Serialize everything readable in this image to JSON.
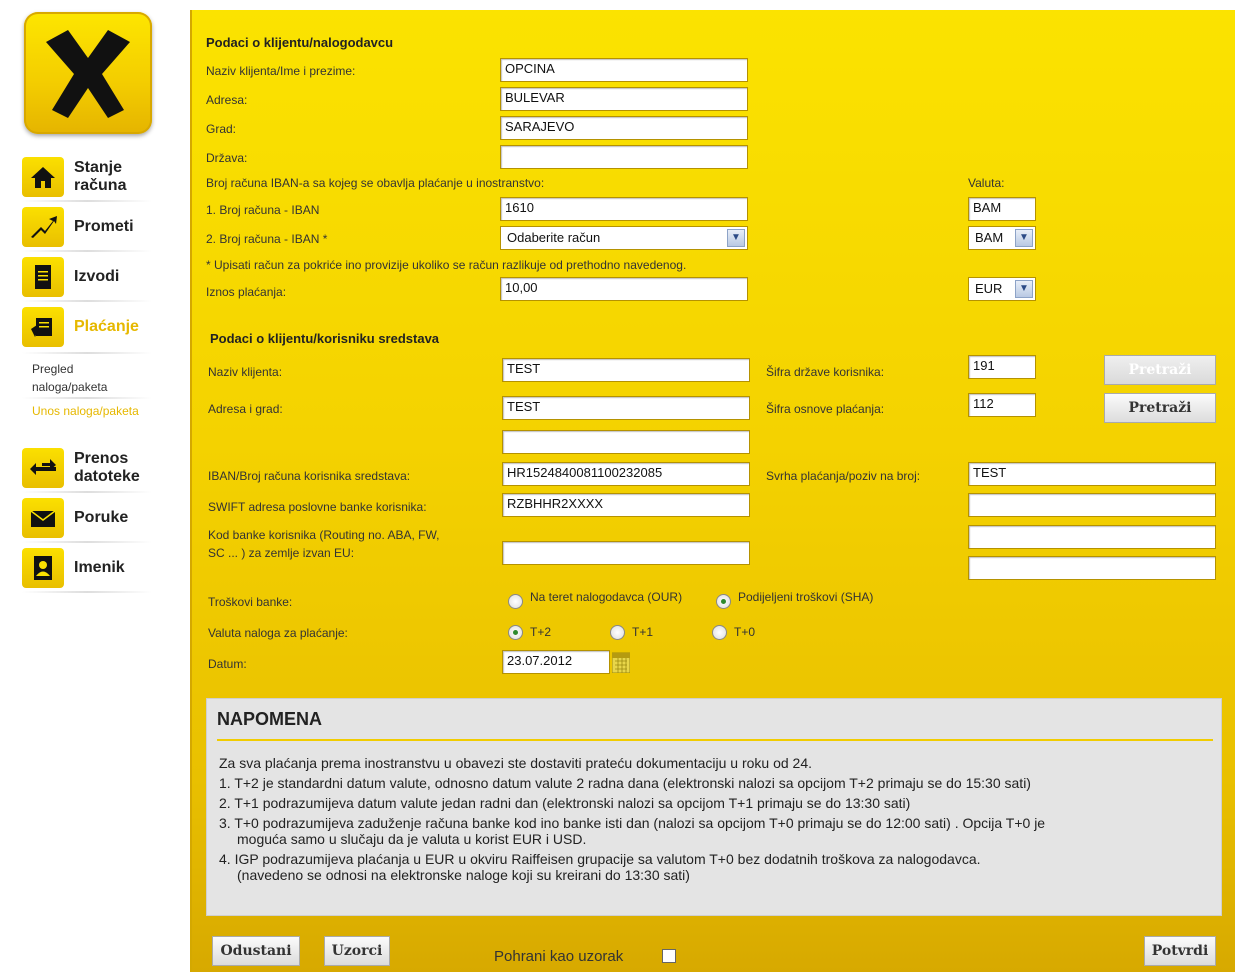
{
  "nav": [
    {
      "label": "Stanje računa"
    },
    {
      "label": "Prometi"
    },
    {
      "label": "Izvodi"
    },
    {
      "label": "Plaćanje"
    },
    {
      "label": "Prenos datoteke"
    },
    {
      "label": "Poruke"
    },
    {
      "label": "Imenik"
    }
  ],
  "subnav": {
    "pregled": "Pregled naloga/paketa",
    "unos": "Unos naloga/paketa"
  },
  "sender": {
    "heading": "Podaci o klijentu/nalogodavcu",
    "name_label": "Naziv klijenta/Ime i prezime:",
    "name_value": "OPCINA",
    "address_label": "Adresa:",
    "address_value": "BULEVAR",
    "city_label": "Grad:",
    "city_value": "SARAJEVO",
    "country_label": "Država:",
    "country_value": "",
    "iban_intro": "Broj računa IBAN-a sa kojeg se obavlja plaćanje u inostranstvo:",
    "currency_label": "Valuta:",
    "acc1_label": "1. Broj računa - IBAN",
    "acc1_value": "1610",
    "acc1_currency": "BAM",
    "acc2_label": "2. Broj računa - IBAN *",
    "acc2_value": "Odaberite račun",
    "acc2_currency": "BAM",
    "acc_note": "* Upisati račun za pokriće ino provizije ukoliko se račun razlikuje od prethodno navedenog.",
    "amount_label": "Iznos plaćanja:",
    "amount_value": "10,00",
    "amount_currency": "EUR"
  },
  "beneficiary": {
    "heading": "Podaci o klijentu/korisniku sredstava",
    "name_label": "Naziv klijenta:",
    "name_value": "TEST",
    "country_code_label": "Šifra države korisnika:",
    "country_code_value": "191",
    "address_label": "Adresa i grad:",
    "address_value": "TEST",
    "address_value2": "",
    "basis_code_label": "Šifra osnove plaćanja:",
    "basis_code_value": "112",
    "search_label": "Pretraži",
    "iban_label": "IBAN/Broj računa korisnika sredstava:",
    "iban_value": "HR1524840081100232085",
    "purpose_label": "Svrha plaćanja/poziv na broj:",
    "purpose_value": "TEST",
    "swift_label": "SWIFT adresa poslovne banke korisnika:",
    "swift_value": "RZBHHR2XXXX",
    "routing_label_1": "Kod banke korisnika (Routing no. ABA, FW,",
    "routing_label_2": "SC ... ) za zemlje izvan EU:",
    "routing_value": "",
    "fees_label": "Troškovi banke:",
    "fee_our": "Na teret nalogodavca (OUR)",
    "fee_sha": "Podijeljeni troškovi (SHA)",
    "value_date_label": "Valuta naloga za plaćanje:",
    "t2": "T+2",
    "t1": "T+1",
    "t0": "T+0",
    "date_label": "Datum:",
    "date_value": "23.07.2012"
  },
  "note": {
    "title": "NAPOMENA",
    "intro": "Za sva plaćanja prema inostranstvu u obavezi ste dostaviti prateću dokumentaciju u roku od 24.",
    "l1": "1. T+2 je standardni datum valute, odnosno datum valute 2 radna dana (elektronski nalozi sa opcijom T+2 primaju se do 15:30 sati)",
    "l2": "2. T+1 podrazumijeva datum valute jedan radni dan (elektronski nalozi sa opcijom T+1 primaju se do 13:30 sati)",
    "l3a": "3. T+0 podrazumijeva zaduženje računa banke kod ino banke isti dan (nalozi sa opcijom T+0 primaju se do 12:00 sati) . Opcija T+0 je",
    "l3b": "moguća samo u slučaju da je valuta u korist EUR i USD.",
    "l4a": "4. IGP podrazumijeva plaćanja u EUR u okviru Raiffeisen grupacije sa valutom T+0 bez dodatnih troškova za nalogodavca.",
    "l4b": "(navedeno se odnosi na elektronske naloge koji su kreirani do 13:30 sati)"
  },
  "footer": {
    "cancel": "Odustani",
    "templates": "Uzorci",
    "save_template": "Pohrani kao uzorak",
    "confirm": "Potvrdi"
  }
}
